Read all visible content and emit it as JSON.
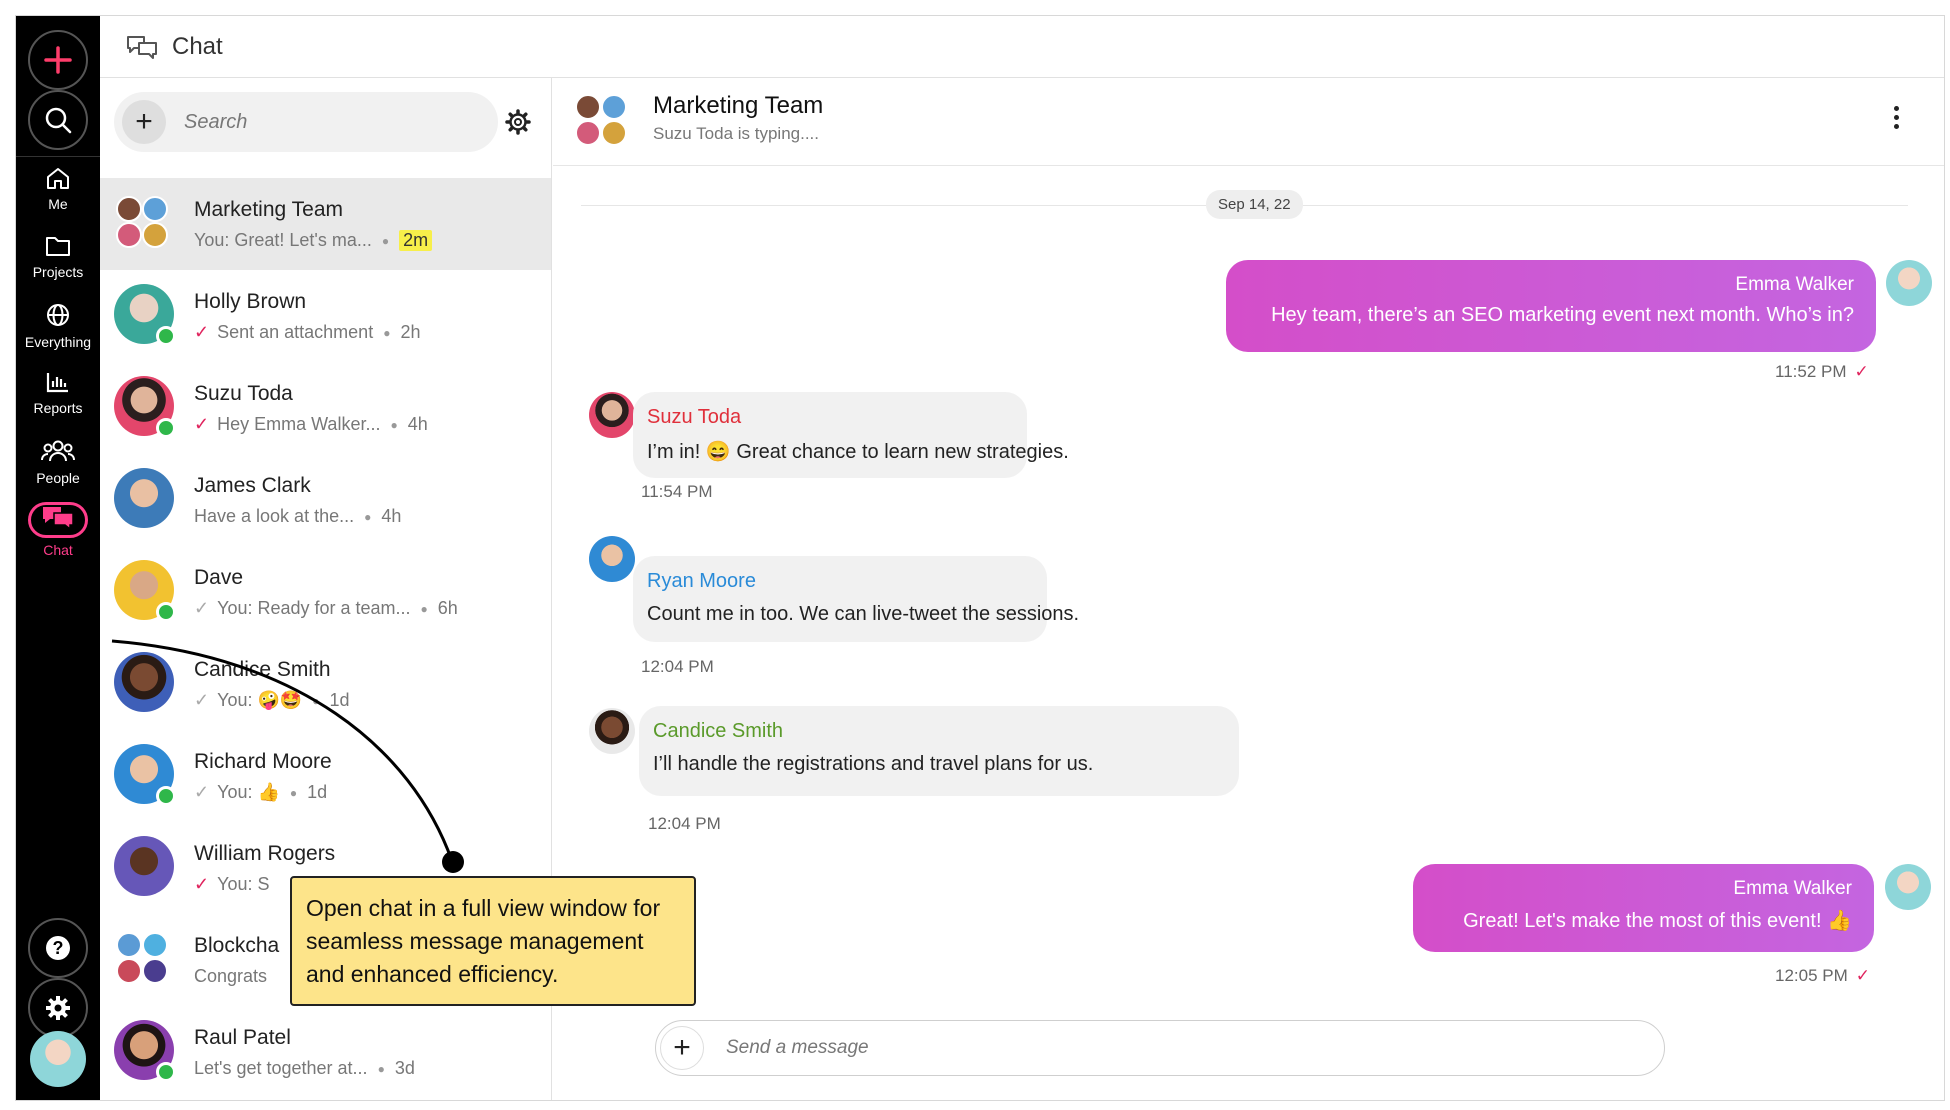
{
  "header": {
    "title": "Chat"
  },
  "rail": {
    "items": [
      {
        "label": "Me",
        "icon": "home-icon"
      },
      {
        "label": "Projects",
        "icon": "folder-icon"
      },
      {
        "label": "Everything",
        "icon": "globe-icon"
      },
      {
        "label": "Reports",
        "icon": "bar-chart-icon"
      },
      {
        "label": "People",
        "icon": "people-icon"
      },
      {
        "label": "Chat",
        "icon": "chat-icon"
      }
    ]
  },
  "search": {
    "placeholder": "Search"
  },
  "conversations": [
    {
      "name": "Marketing Team",
      "preview": "You: Great! Let's ma...",
      "time": "2m",
      "status": "none",
      "online": false,
      "group": true
    },
    {
      "name": "Holly Brown",
      "preview": "Sent an attachment",
      "time": "2h",
      "status": "read",
      "online": true
    },
    {
      "name": "Suzu Toda",
      "preview": "Hey Emma Walker...",
      "time": "4h",
      "status": "read",
      "online": true
    },
    {
      "name": "James Clark",
      "preview": "Have a look at the...",
      "time": "4h",
      "status": "none",
      "online": false
    },
    {
      "name": "Dave",
      "preview": "You: Ready for a team...",
      "time": "6h",
      "status": "sent",
      "online": true
    },
    {
      "name": "Candice Smith",
      "preview": "You: 🤪🤩",
      "time": "1d",
      "status": "sent",
      "online": false
    },
    {
      "name": "Richard Moore",
      "preview": "You: 👍",
      "time": "1d",
      "status": "sent",
      "online": true
    },
    {
      "name": "William Rogers",
      "preview": "You: S",
      "time": "",
      "status": "read",
      "online": false
    },
    {
      "name": "Blockcha",
      "preview": "Congrats",
      "time": "",
      "status": "none",
      "online": false,
      "group": true
    },
    {
      "name": "Raul Patel",
      "preview": "Let's get together at...",
      "time": "3d",
      "status": "none",
      "online": true
    }
  ],
  "chat": {
    "title": "Marketing Team",
    "typing": "Suzu Toda is typing....",
    "date": "Sep 14, 22",
    "messages": [
      {
        "from": "Emma Walker",
        "text": "Hey team, there’s an SEO marketing event next month. Who’s in?",
        "time": "11:52 PM",
        "outgoing": true
      },
      {
        "from": "Suzu Toda",
        "text": "I’m in! 😄 Great chance to learn new strategies.",
        "time": "11:54 PM",
        "outgoing": false,
        "color": "#e0303b"
      },
      {
        "from": "Ryan Moore",
        "text": "Count me in too. We can live-tweet the sessions.",
        "time": "12:04 PM",
        "outgoing": false,
        "color": "#2a8bd8"
      },
      {
        "from": "Candice Smith",
        "text": "I’ll handle the registrations and travel plans for us.",
        "time": "12:04 PM",
        "outgoing": false,
        "color": "#5a9a2a"
      },
      {
        "from": "Emma Walker",
        "text": "Great! Let's make the most of this event! 👍",
        "time": "12:05 PM",
        "outgoing": true
      }
    ],
    "compose_placeholder": "Send a message"
  },
  "annotation": {
    "text": "Open chat in a full view window for seamless message management and enhanced efficiency."
  },
  "colors": {
    "accent": "#ff3d8b",
    "bubble_out": "#d44ec9",
    "online": "#2fb74a",
    "highlight": "#f7ef4a"
  }
}
